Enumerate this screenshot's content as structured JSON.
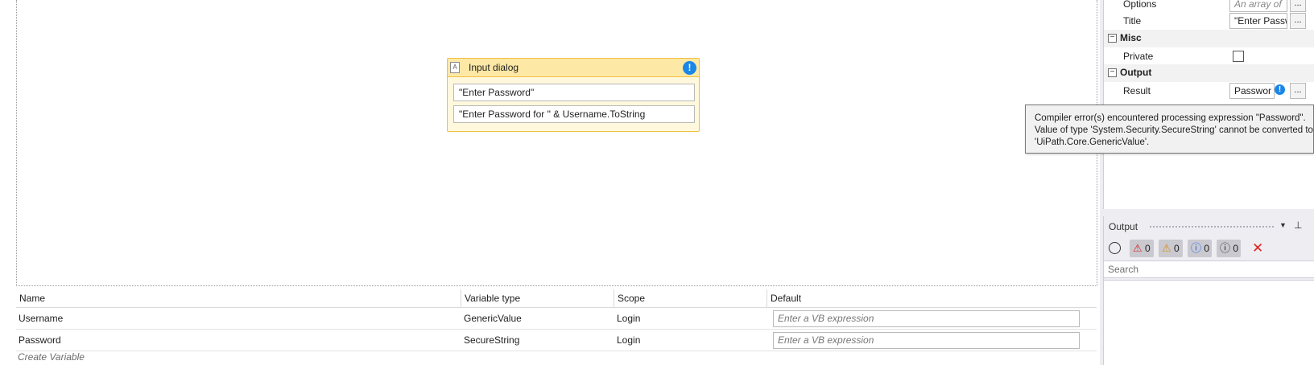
{
  "designer": {
    "activity": {
      "icon": "text-document-icon",
      "title": "Input dialog",
      "warning_icon": "info-warning-icon",
      "title_field": "\"Enter Password\"",
      "label_field": "\"Enter Password for \" & Username.ToString"
    }
  },
  "variables": {
    "columns": [
      "Name",
      "Variable type",
      "Scope",
      "Default"
    ],
    "rows": [
      {
        "name": "Username",
        "type": "GenericValue",
        "scope": "Login",
        "default_placeholder": "Enter a VB expression"
      },
      {
        "name": "Password",
        "type": "SecureString",
        "scope": "Login",
        "default_placeholder": "Enter a VB expression"
      }
    ],
    "create_label": "Create Variable"
  },
  "properties": {
    "options_label": "Options",
    "options_value": "An array of",
    "title_label": "Title",
    "title_value": "\"Enter Passw",
    "misc_category": "Misc",
    "private_label": "Private",
    "output_category": "Output",
    "result_label": "Result",
    "result_value": "Passwor",
    "ellipsis": "...",
    "collapse_glyph": "−",
    "info_glyph": "!"
  },
  "output_panel": {
    "title": "Output",
    "dropdown_glyph": "▼",
    "pin_glyph": "⊥",
    "errors_count": "0",
    "warnings_count": "0",
    "info_count": "0",
    "trace_count": "0",
    "search_placeholder": "Search",
    "clear_glyph": "✕"
  },
  "tooltip": {
    "line1": "Compiler error(s) encountered processing expression \"Password\".",
    "line2": "Value of type 'System.Security.SecureString' cannot be converted to",
    "line3": "'UiPath.Core.GenericValue'."
  },
  "colors": {
    "activity_header": "#fde8a5",
    "activity_border": "#f0c040",
    "info_blue": "#1a86e8",
    "error_red": "#e02020",
    "warning_orange": "#e08a1a"
  }
}
